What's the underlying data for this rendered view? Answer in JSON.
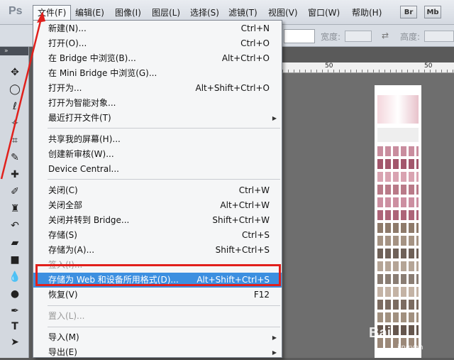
{
  "app": {
    "logo": "Ps"
  },
  "menubar": {
    "items": [
      {
        "label": "文件(F)"
      },
      {
        "label": "编辑(E)"
      },
      {
        "label": "图像(I)"
      },
      {
        "label": "图层(L)"
      },
      {
        "label": "选择(S)"
      },
      {
        "label": "滤镜(T)"
      },
      {
        "label": "视图(V)"
      },
      {
        "label": "窗口(W)"
      },
      {
        "label": "帮助(H)"
      }
    ],
    "bridge_badge": "Br",
    "minibridge_badge": "Mb"
  },
  "options": {
    "width_label": "宽度:",
    "height_label": "高度:"
  },
  "ruler": {
    "ticks": [
      "50",
      "50"
    ]
  },
  "file_menu": {
    "items": [
      {
        "label": "新建(N)...",
        "shortcut": "Ctrl+N"
      },
      {
        "label": "打开(O)...",
        "shortcut": "Ctrl+O"
      },
      {
        "label": "在 Bridge 中浏览(B)...",
        "shortcut": "Alt+Ctrl+O"
      },
      {
        "label": "在 Mini Bridge 中浏览(G)...",
        "shortcut": ""
      },
      {
        "label": "打开为...",
        "shortcut": "Alt+Shift+Ctrl+O"
      },
      {
        "label": "打开为智能对象...",
        "shortcut": ""
      },
      {
        "label": "最近打开文件(T)",
        "shortcut": ""
      },
      {
        "label": "共享我的屏幕(H)...",
        "shortcut": ""
      },
      {
        "label": "创建新审核(W)...",
        "shortcut": ""
      },
      {
        "label": "Device Central...",
        "shortcut": ""
      },
      {
        "label": "关闭(C)",
        "shortcut": "Ctrl+W"
      },
      {
        "label": "关闭全部",
        "shortcut": "Alt+Ctrl+W"
      },
      {
        "label": "关闭并转到 Bridge...",
        "shortcut": "Shift+Ctrl+W"
      },
      {
        "label": "存储(S)",
        "shortcut": "Ctrl+S"
      },
      {
        "label": "存储为(A)...",
        "shortcut": "Shift+Ctrl+S"
      },
      {
        "label": "签入(I)...",
        "shortcut": ""
      },
      {
        "label": "存储为 Web 和设备所用格式(D)...",
        "shortcut": "Alt+Shift+Ctrl+S"
      },
      {
        "label": "恢复(V)",
        "shortcut": "F12"
      },
      {
        "label": "置入(L)...",
        "shortcut": ""
      },
      {
        "label": "导入(M)",
        "shortcut": ""
      },
      {
        "label": "导出(E)",
        "shortcut": ""
      }
    ]
  },
  "watermark": {
    "text": "Bai",
    "sub": "jingyan"
  },
  "colors": {
    "highlight": "#3c8fe0",
    "annotation": "#e1201c"
  }
}
